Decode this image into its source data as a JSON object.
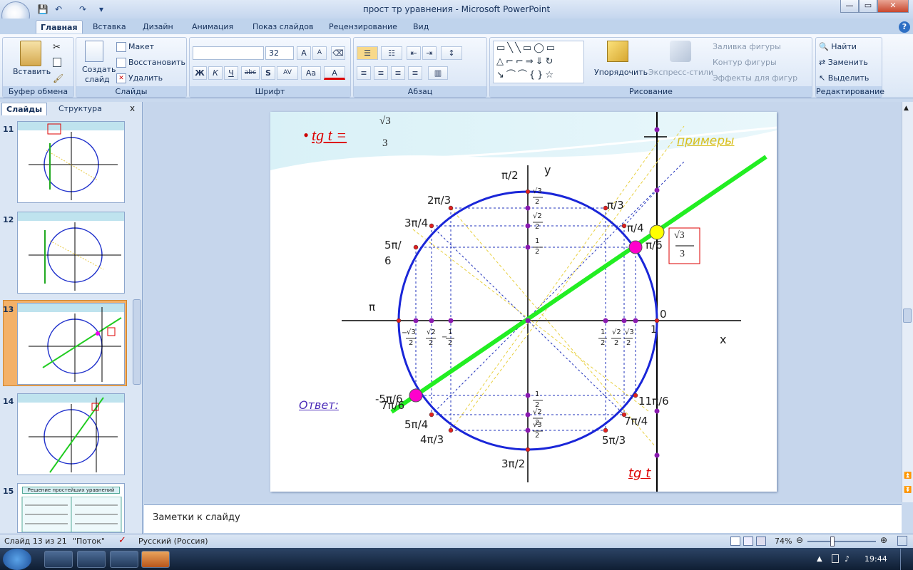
{
  "window": {
    "title": "прост тр уравнения - Microsoft PowerPoint",
    "buttons": [
      "—",
      "▭",
      "✕"
    ]
  },
  "quick_access": [
    "💾",
    "↶",
    "↷",
    "▾"
  ],
  "tabs": [
    "Главная",
    "Вставка",
    "Дизайн",
    "Анимация",
    "Показ слайдов",
    "Рецензирование",
    "Вид"
  ],
  "help_icon": "?",
  "ribbon": {
    "clipboard": {
      "label": "Буфер обмена",
      "paste": "Вставить"
    },
    "slides": {
      "label": "Слайды",
      "create": "Создать",
      "create2": "слайд",
      "layout": "Макет",
      "reset": "Восстановить",
      "delete": "Удалить"
    },
    "font": {
      "label": "Шрифт",
      "size": "32",
      "bold": "Ж",
      "italic": "К",
      "underline": "Ч",
      "strike": "abc",
      "shadow": "S",
      "spacing": "AV",
      "case": "Aa",
      "color": "A",
      "grow": "A",
      "shrink": "A"
    },
    "paragraph": {
      "label": "Абзац"
    },
    "drawing": {
      "label": "Рисование",
      "arrange": "Упорядочить",
      "express": "Экспресс-стили",
      "fill": "Заливка фигуры",
      "outline": "Контур фигуры",
      "effects": "Эффекты для фигур"
    },
    "editing": {
      "label": "Редактирование",
      "find": "Найти",
      "replace": "Заменить",
      "select": "Выделить"
    }
  },
  "pane": {
    "tabs": [
      "Слайды",
      "Структура"
    ],
    "close": "x",
    "slide_numbers": [
      "11",
      "12",
      "13",
      "14",
      "15"
    ],
    "thumb15_title": "Решение простейших уравнений"
  },
  "slide": {
    "heading_bullet": "•",
    "heading": "tg t =",
    "heading_value": {
      "num": "√3",
      "den": "3"
    },
    "examples": "примеры",
    "answer": "Ответ:",
    "axis_x": "x",
    "axis_y": "y",
    "tg_label": "tg t",
    "boxed_value": {
      "num": "√3",
      "den": "3"
    },
    "origin_label": "0",
    "one_label": "1",
    "angle_labels": {
      "pi_over_2": "π/2",
      "two_pi_3": "2π/3",
      "pi_3": "π/3",
      "three_pi_4": "3π/4",
      "pi_4": "π/4",
      "five_pi_6_top": "5π/",
      "five_pi_6_bottom": "6",
      "pi_6": "π/6",
      "pi": "π",
      "minus_five_pi_6": "-5π/6",
      "seven_pi_6": "7π/6",
      "eleven_pi_6": "11π/6",
      "five_pi_4": "5π/4",
      "seven_pi_4": "7π/4",
      "four_pi_3": "4π/3",
      "five_pi_3": "5π/3",
      "three_pi_2": "3π/2"
    },
    "fractions": {
      "sqrt3": "√3",
      "sqrt2": "√2",
      "one": "1",
      "two": "2",
      "minus": "−"
    }
  },
  "notes": {
    "placeholder": "Заметки к слайду"
  },
  "status": {
    "slide": "Слайд 13 из 21",
    "theme": "\"Поток\"",
    "language": "Русский (Россия)",
    "zoom": "74%"
  },
  "taskbar": {
    "time": "19:44"
  }
}
